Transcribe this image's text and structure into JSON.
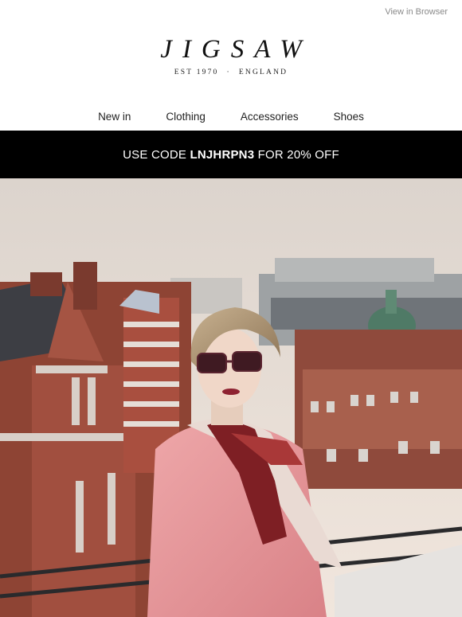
{
  "header": {
    "view_in_browser": "View in Browser",
    "logo_text": "JIGSAW",
    "tagline_left": "EST 1970",
    "tagline_sep": "·",
    "tagline_right": "ENGLAND"
  },
  "nav": {
    "items": [
      {
        "label": "New in"
      },
      {
        "label": "Clothing"
      },
      {
        "label": "Accessories"
      },
      {
        "label": "Shoes"
      }
    ]
  },
  "promo": {
    "prefix": "USE CODE ",
    "code": "LNJHRPN3",
    "suffix": " FOR 20% OFF"
  },
  "colors": {
    "promo_bg": "#000000",
    "jacket": "#e79a9d",
    "brick": "#9a4a38",
    "sky": "#e9dfd8"
  }
}
